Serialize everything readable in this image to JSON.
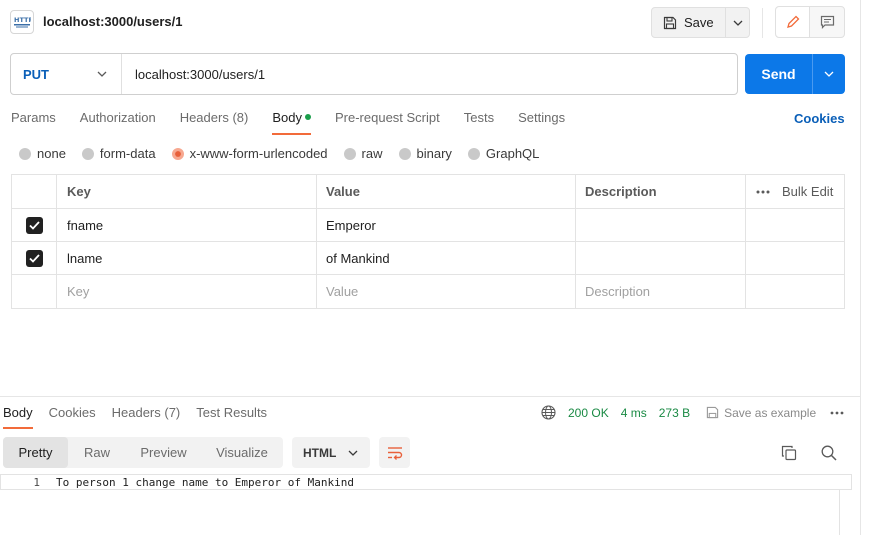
{
  "header": {
    "http_icon_label": "HTTP",
    "request_title": "localhost:3000/users/1",
    "save_label": "Save"
  },
  "request": {
    "method": "PUT",
    "url": "localhost:3000/users/1",
    "send_label": "Send"
  },
  "request_tabs": [
    {
      "label": "Params"
    },
    {
      "label": "Authorization"
    },
    {
      "label": "Headers",
      "count": "(8)"
    },
    {
      "label": "Body",
      "active": true
    },
    {
      "label": "Pre-request Script"
    },
    {
      "label": "Tests"
    },
    {
      "label": "Settings"
    }
  ],
  "cookies_label": "Cookies",
  "body_types": [
    {
      "label": "none"
    },
    {
      "label": "form-data"
    },
    {
      "label": "x-www-form-urlencoded",
      "selected": true
    },
    {
      "label": "raw"
    },
    {
      "label": "binary"
    },
    {
      "label": "GraphQL"
    }
  ],
  "kv_table": {
    "headers": {
      "key": "Key",
      "value": "Value",
      "description": "Description",
      "bulk_edit": "Bulk Edit"
    },
    "rows": [
      {
        "checked": true,
        "key": "fname",
        "value": "Emperor",
        "description": ""
      },
      {
        "checked": true,
        "key": "lname",
        "value": "of Mankind",
        "description": ""
      }
    ],
    "placeholders": {
      "key": "Key",
      "value": "Value",
      "description": "Description"
    }
  },
  "response": {
    "tabs": [
      {
        "label": "Body",
        "active": true
      },
      {
        "label": "Cookies"
      },
      {
        "label": "Headers (7)"
      },
      {
        "label": "Test Results"
      }
    ],
    "status": "200 OK",
    "time": "4 ms",
    "size": "273 B",
    "save_example": "Save as example",
    "views": [
      "Pretty",
      "Raw",
      "Preview",
      "Visualize"
    ],
    "format": "HTML",
    "lines": [
      {
        "num": "1",
        "text": "To person 1 change name to Emperor of Mankind"
      }
    ]
  },
  "colors": {
    "accent_orange": "#f26b3a",
    "send_blue": "#0c78e8",
    "method_blue": "#0a5fb8",
    "status_green": "#1a8a44"
  }
}
